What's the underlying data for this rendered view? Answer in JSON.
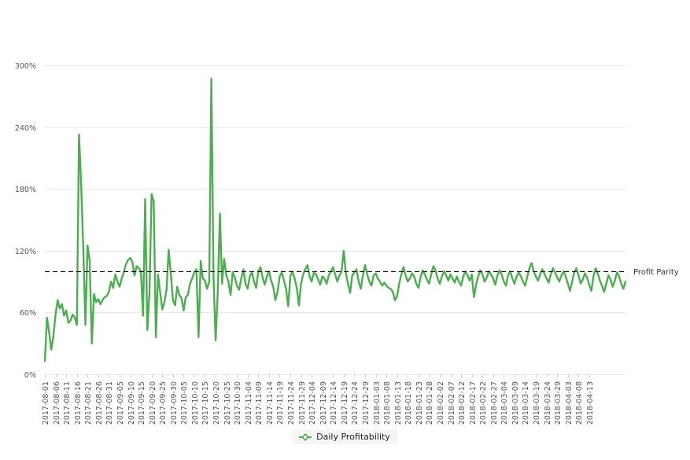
{
  "chart_data": {
    "type": "line",
    "title": "",
    "subtitle": "",
    "xlabel": "",
    "ylabel": "",
    "ylim": [
      0,
      310
    ],
    "ytick_values": [
      0,
      60,
      120,
      180,
      240,
      300
    ],
    "ytick_labels": [
      "0%",
      "60%",
      "120%",
      "180%",
      "240%",
      "300%"
    ],
    "grid": true,
    "grid_axis": "y",
    "legend_position": "bottom-center",
    "series": [
      {
        "name": "Daily Profitability",
        "color": "#4cae4f",
        "values": [
          13,
          55,
          41,
          24,
          37,
          58,
          72,
          64,
          68,
          57,
          62,
          50,
          52,
          58,
          55,
          48,
          233,
          185,
          122,
          48,
          125,
          110,
          30,
          78,
          70,
          73,
          68,
          72,
          75,
          76,
          80,
          90,
          84,
          97,
          90,
          85,
          93,
          99,
          107,
          111,
          113,
          109,
          96,
          105,
          103,
          100,
          57,
          170,
          43,
          79,
          175,
          168,
          36,
          97,
          80,
          63,
          70,
          82,
          121,
          98,
          72,
          67,
          85,
          77,
          74,
          62,
          75,
          77,
          88,
          93,
          99,
          102,
          36,
          110,
          93,
          91,
          83,
          90,
          287,
          95,
          33,
          80,
          156,
          88,
          112,
          96,
          90,
          77,
          99,
          94,
          86,
          82,
          93,
          102,
          88,
          83,
          95,
          99,
          90,
          84,
          100,
          104,
          94,
          87,
          95,
          100,
          91,
          85,
          72,
          80,
          95,
          99,
          91,
          83,
          66,
          95,
          100,
          93,
          84,
          67,
          88,
          97,
          102,
          106,
          95,
          90,
          99,
          97,
          92,
          87,
          95,
          93,
          88,
          96,
          100,
          104,
          97,
          90,
          96,
          100,
          120,
          98,
          88,
          79,
          96,
          99,
          102,
          90,
          83,
          96,
          106,
          97,
          90,
          86,
          96,
          98,
          93,
          90,
          86,
          89,
          86,
          84,
          83,
          80,
          72,
          76,
          88,
          97,
          104,
          96,
          90,
          93,
          98,
          95,
          88,
          84,
          94,
          101,
          97,
          92,
          88,
          97,
          105,
          101,
          93,
          88,
          95,
          100,
          96,
          91,
          97,
          93,
          89,
          95,
          90,
          86,
          95,
          100,
          96,
          91,
          97,
          75,
          87,
          95,
          101,
          97,
          90,
          94,
          100,
          97,
          93,
          87,
          96,
          101,
          97,
          90,
          86,
          96,
          100,
          93,
          88,
          95,
          99,
          95,
          90,
          86,
          95,
          103,
          108,
          100,
          95,
          91,
          97,
          102,
          98,
          93,
          89,
          97,
          103,
          99,
          94,
          90,
          96,
          100,
          95,
          88,
          81,
          90,
          99,
          103,
          96,
          88,
          92,
          98,
          94,
          87,
          81,
          95,
          103,
          98,
          91,
          86,
          80,
          88,
          96,
          92,
          85,
          91,
          99,
          95,
          88,
          83,
          90
        ]
      }
    ],
    "x_tick_labels": [
      "2017-08-01",
      "2017-08-06",
      "2017-08-11",
      "2017-08-16",
      "2017-08-21",
      "2017-08-26",
      "2017-08-31",
      "2017-09-05",
      "2017-09-10",
      "2017-09-15",
      "2017-09-20",
      "2017-09-25",
      "2017-09-30",
      "2017-10-05",
      "2017-10-10",
      "2017-10-15",
      "2017-10-20",
      "2017-10-25",
      "2017-10-30",
      "2017-11-04",
      "2017-11-09",
      "2017-11-14",
      "2017-11-19",
      "2017-11-24",
      "2017-11-29",
      "2017-12-04",
      "2017-12-09",
      "2017-12-14",
      "2017-12-19",
      "2017-12-24",
      "2017-12-29",
      "2018-01-03",
      "2018-01-08",
      "2018-01-13",
      "2018-01-18",
      "2018-01-23",
      "2018-01-28",
      "2018-02-02",
      "2018-02-07",
      "2018-02-12",
      "2018-02-17",
      "2018-02-22",
      "2018-02-27",
      "2018-03-04",
      "2018-03-09",
      "2018-03-14",
      "2018-03-19",
      "2018-03-24",
      "2018-03-29",
      "2018-04-03",
      "2018-04-08",
      "2018-04-13"
    ],
    "x_tick_interval": 5,
    "annotations": [
      {
        "name": "profit-parity",
        "label": "Profit Parity",
        "value": 100,
        "orientation": "horizontal",
        "style": "dashed",
        "color": "#000000"
      }
    ]
  },
  "legend": {
    "entries": [
      {
        "label": "Daily Profitability",
        "color": "#4cae4f",
        "marker": "line-diamond"
      }
    ]
  },
  "axis": {
    "y_label_color": "#555555",
    "x_label_color": "#555555",
    "grid_color": "#e8e8e8"
  }
}
